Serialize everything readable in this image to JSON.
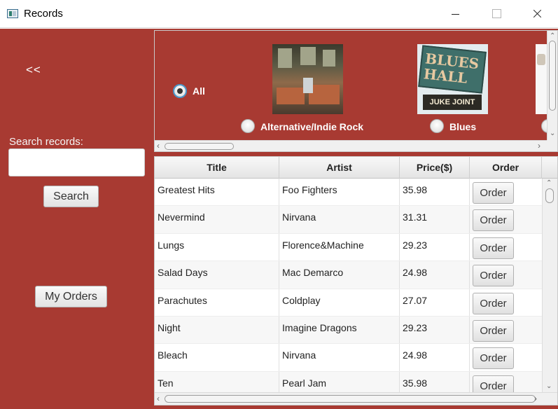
{
  "window": {
    "title": "Records",
    "minimize_icon": "minimize-icon",
    "maximize_icon": "maximize-icon",
    "close_icon": "close-icon"
  },
  "colors": {
    "background": "#a83a32",
    "radio_focus": "#4b96c8"
  },
  "sidebar": {
    "back_label": "<<",
    "search_label": "Search records:",
    "search_value": "",
    "search_button": "Search",
    "my_orders_button": "My Orders"
  },
  "genres": [
    {
      "label": "All",
      "selected": true
    },
    {
      "label": "Alternative/Indie Rock",
      "selected": false,
      "cover": "subway-interior-album-cover"
    },
    {
      "label": "Blues",
      "selected": false,
      "cover": "blues-hall-sign-album-cover",
      "cover_text": "BLUES HALL",
      "cover_sign": "JUKE JOINT"
    },
    {
      "label": "",
      "selected": false,
      "cover": "partial-album-cover"
    }
  ],
  "table": {
    "columns": [
      "Title",
      "Artist",
      "Price($)",
      "Order"
    ],
    "order_button": "Order",
    "rows": [
      {
        "title": "Greatest Hits",
        "artist": "Foo Fighters",
        "price": "35.98"
      },
      {
        "title": "Nevermind",
        "artist": "Nirvana",
        "price": "31.31"
      },
      {
        "title": "Lungs",
        "artist": "Florence&Machine",
        "price": "29.23"
      },
      {
        "title": "Salad Days",
        "artist": "Mac Demarco",
        "price": "24.98"
      },
      {
        "title": "Parachutes",
        "artist": "Coldplay",
        "price": "27.07"
      },
      {
        "title": "Night",
        "artist": "Imagine Dragons",
        "price": "29.23"
      },
      {
        "title": "Bleach",
        "artist": "Nirvana",
        "price": "24.98"
      },
      {
        "title": "Ten",
        "artist": "Pearl Jam",
        "price": "35.98"
      }
    ]
  }
}
